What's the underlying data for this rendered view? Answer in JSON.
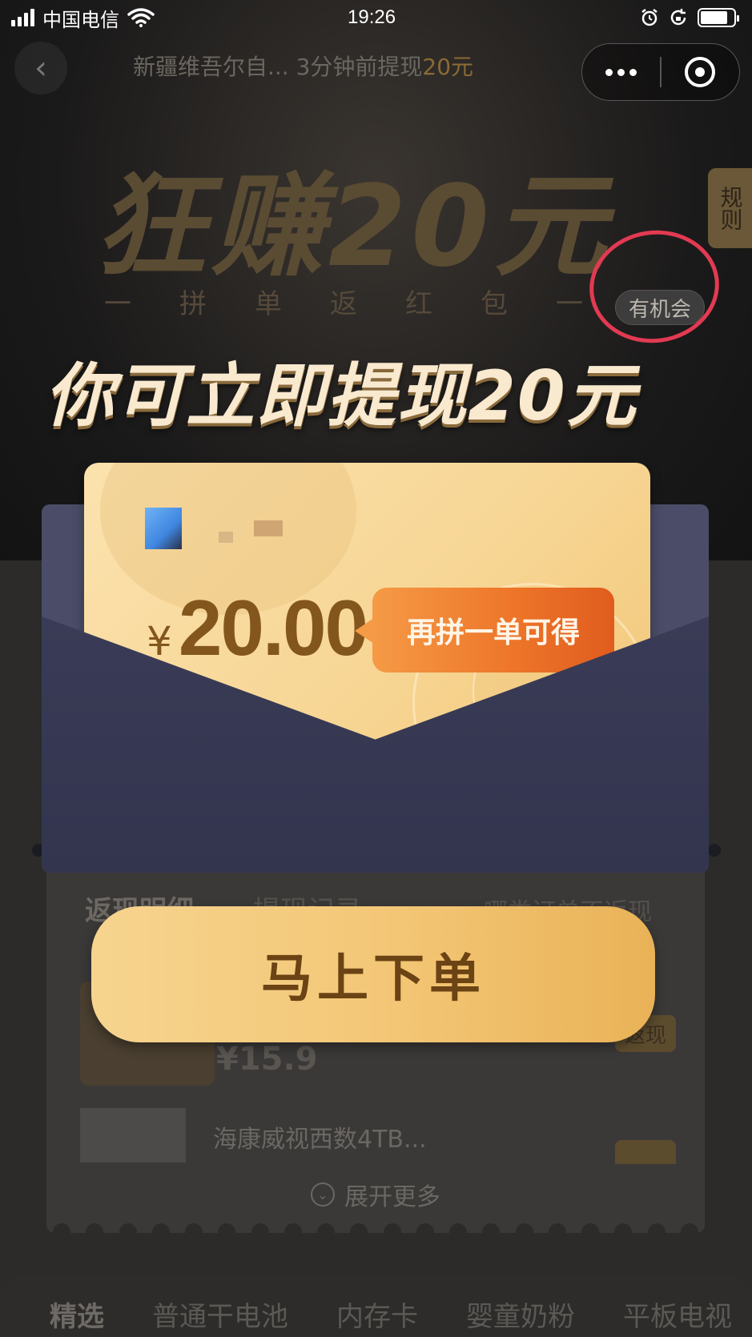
{
  "status_bar": {
    "carrier": "中国电信",
    "time": "19:26"
  },
  "topbar": {
    "ticker_prefix": "新疆维吾尔自... 3分钟前提现",
    "ticker_amount": "20元"
  },
  "hero": {
    "title": "狂赚20元",
    "subtitle": "一拼单返红包一",
    "rules_tab": "规则",
    "chance_badge": "有机会"
  },
  "modal": {
    "headline": "你可立即提现20元",
    "currency_symbol": "¥",
    "amount": "20.00",
    "hint": "再拼一单可得",
    "order_button": "马上下单"
  },
  "background": {
    "tab_detail": "返现明细",
    "tab_record": "提现记录",
    "tab_right": "哪类订单不返现",
    "product1_price": "¥15.9",
    "product1_badge": "返现",
    "product2_name": "海康威视西数4TB...",
    "expand_more": "展开更多"
  },
  "category_bar": {
    "items": [
      "精选",
      "普通干电池",
      "内存卡",
      "婴童奶粉",
      "平板电视"
    ]
  },
  "colors": {
    "accent_gold": "#f3c675",
    "hint_orange": "#ed7429",
    "annotation_red": "#e23a52"
  }
}
